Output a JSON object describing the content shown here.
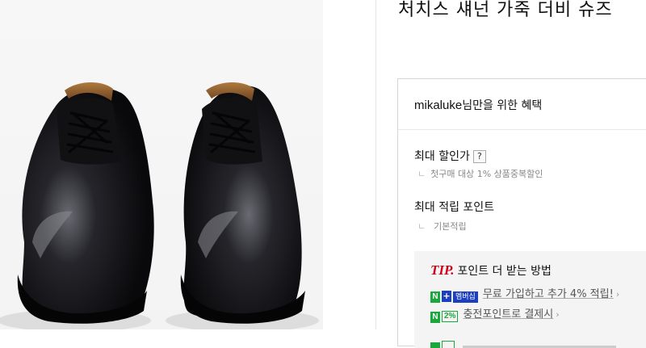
{
  "product": {
    "title": "처치스 섀넌 가죽 더비 슈즈",
    "image_alt": "black-leather-derby-shoes"
  },
  "benefits": {
    "header_user": "mikaluke",
    "header_suffix": "님만을 위한 혜택",
    "max_discount_label": "최대 할인가",
    "help_glyph": "?",
    "discount_sub": "첫구매 대상 1% 상품중복할인",
    "branch_glyph": "ㄴ",
    "max_points_label": "최대 적립 포인트",
    "points_sub": "기본적립"
  },
  "tip": {
    "tip_word": "TIP.",
    "title": "포인트 더 받는 방법",
    "membership_badge_n": "N",
    "membership_badge_plus": "+",
    "membership_badge_text": "멤버십",
    "membership_link": "무료 가입하고 추가 4% 적립!",
    "pay_badge_n": "N",
    "pay_badge_pct": "2%",
    "pay_link": "충전포인트로 결제시",
    "chevron": "›"
  },
  "colors": {
    "tip_red": "#d0021b",
    "naver_green": "#18a83c",
    "membership_blue": "#1b3fbf"
  }
}
